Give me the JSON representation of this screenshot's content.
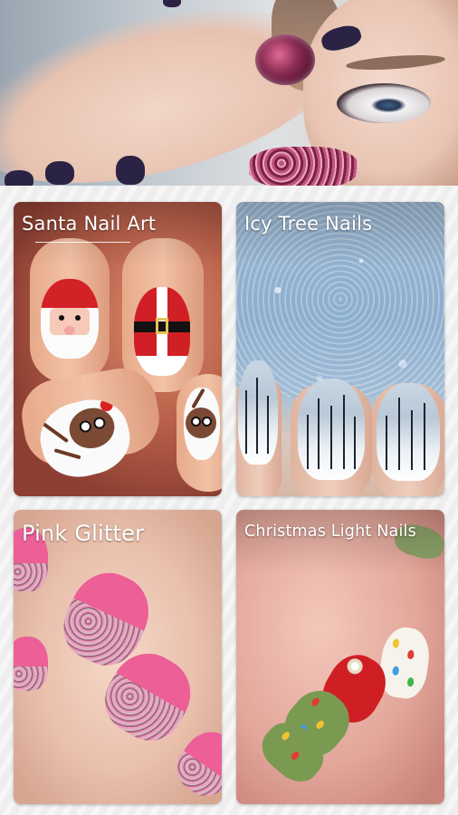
{
  "hero": {
    "image": "hand-with-dark-nail-polish-and-jeweled-ring"
  },
  "cards": [
    {
      "title": "Santa Nail Art",
      "image": "santa-and-reindeer-nails"
    },
    {
      "title": "Icy Tree Nails",
      "image": "icy-winter-tree-nails"
    },
    {
      "title": "Pink Glitter",
      "image": "pink-glitter-nails"
    },
    {
      "title": "Christmas Light Nails",
      "image": "christmas-light-nails"
    }
  ],
  "colors": {
    "background": "#eeeeee",
    "title_text": "#ffffff"
  }
}
